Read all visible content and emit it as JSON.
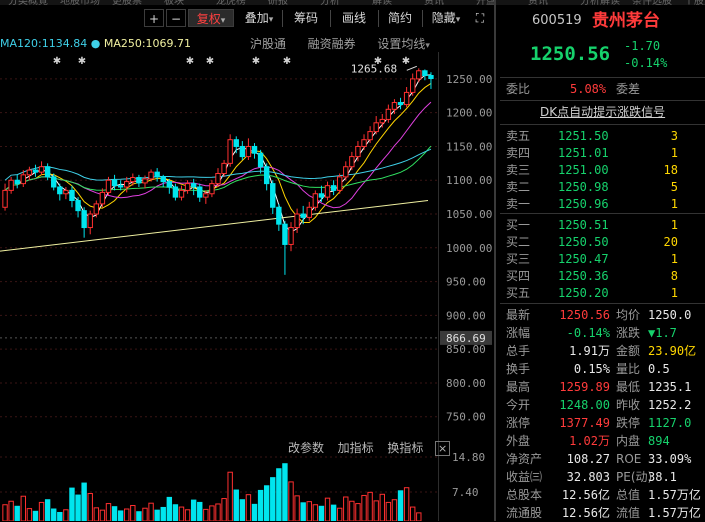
{
  "top_strip": [
    "分类概覧",
    "地股市场",
    "更股票",
    "板块",
    "龙虎榜",
    "研报",
    "分析",
    "解读",
    "资讯",
    "开盘",
    "资讯",
    "分析解读",
    "条件选股",
    "个股资讯"
  ],
  "toolbar": {
    "plus": "+",
    "minus": "−",
    "fuquan": "复权",
    "diejia": "叠加",
    "chouma": "筹码",
    "huaxian": "画线",
    "jianyue": "简约",
    "yincang": "隐藏",
    "dropdown_glyph": "▾",
    "expand_glyph": "⛶"
  },
  "ma_legend": [
    {
      "label": "MA120:1134.84",
      "color": "#3fd0e8"
    },
    {
      "label": "MA250:1069.71",
      "color": "#f0f0a0"
    }
  ],
  "chart_tabs": [
    "沪股通",
    "融资融券",
    "设置均线"
  ],
  "chart_tabs_dropdown": "▾",
  "price_axis": [
    "1250.00",
    "1200.00",
    "1150.00",
    "1100.00",
    "1050.00",
    "1000.00",
    "950.00",
    "900.00",
    "866.69",
    "850.00",
    "800.00",
    "750.00"
  ],
  "highlight_price": "866.69",
  "volume_axis": [
    "14.80",
    "7.40"
  ],
  "peak_label": "1265.68",
  "mid_tools": {
    "gaicanshu": "改参数",
    "jiazhibiao": "加指标",
    "huanzhibiao": "换指标",
    "close_glyph": "×"
  },
  "chart_data": {
    "type": "candlestick",
    "ylim": [
      720,
      1275
    ],
    "candles": [
      {
        "o": 1060,
        "c": 1085,
        "h": 1095,
        "l": 1055
      },
      {
        "o": 1085,
        "c": 1100,
        "h": 1105,
        "l": 1080
      },
      {
        "o": 1100,
        "c": 1095,
        "h": 1108,
        "l": 1088
      },
      {
        "o": 1095,
        "c": 1108,
        "h": 1115,
        "l": 1090
      },
      {
        "o": 1108,
        "c": 1115,
        "h": 1120,
        "l": 1100
      },
      {
        "o": 1115,
        "c": 1112,
        "h": 1123,
        "l": 1105
      },
      {
        "o": 1112,
        "c": 1120,
        "h": 1128,
        "l": 1108
      },
      {
        "o": 1120,
        "c": 1105,
        "h": 1125,
        "l": 1100
      },
      {
        "o": 1105,
        "c": 1090,
        "h": 1110,
        "l": 1085
      },
      {
        "o": 1090,
        "c": 1080,
        "h": 1095,
        "l": 1070
      },
      {
        "o": 1080,
        "c": 1085,
        "h": 1090,
        "l": 1072
      },
      {
        "o": 1085,
        "c": 1070,
        "h": 1092,
        "l": 1060
      },
      {
        "o": 1070,
        "c": 1055,
        "h": 1075,
        "l": 1045
      },
      {
        "o": 1055,
        "c": 1030,
        "h": 1060,
        "l": 1015
      },
      {
        "o": 1030,
        "c": 1050,
        "h": 1055,
        "l": 1020
      },
      {
        "o": 1050,
        "c": 1065,
        "h": 1070,
        "l": 1045
      },
      {
        "o": 1065,
        "c": 1082,
        "h": 1088,
        "l": 1060
      },
      {
        "o": 1082,
        "c": 1100,
        "h": 1105,
        "l": 1078
      },
      {
        "o": 1100,
        "c": 1092,
        "h": 1108,
        "l": 1085
      },
      {
        "o": 1092,
        "c": 1090,
        "h": 1100,
        "l": 1085
      },
      {
        "o": 1090,
        "c": 1098,
        "h": 1105,
        "l": 1082
      },
      {
        "o": 1098,
        "c": 1104,
        "h": 1110,
        "l": 1092
      },
      {
        "o": 1104,
        "c": 1096,
        "h": 1108,
        "l": 1090
      },
      {
        "o": 1096,
        "c": 1102,
        "h": 1107,
        "l": 1088
      },
      {
        "o": 1102,
        "c": 1112,
        "h": 1116,
        "l": 1098
      },
      {
        "o": 1112,
        "c": 1105,
        "h": 1118,
        "l": 1098
      },
      {
        "o": 1105,
        "c": 1098,
        "h": 1108,
        "l": 1090
      },
      {
        "o": 1098,
        "c": 1090,
        "h": 1102,
        "l": 1080
      },
      {
        "o": 1090,
        "c": 1075,
        "h": 1095,
        "l": 1070
      },
      {
        "o": 1075,
        "c": 1085,
        "h": 1092,
        "l": 1070
      },
      {
        "o": 1085,
        "c": 1095,
        "h": 1100,
        "l": 1080
      },
      {
        "o": 1095,
        "c": 1090,
        "h": 1102,
        "l": 1078
      },
      {
        "o": 1090,
        "c": 1075,
        "h": 1095,
        "l": 1068
      },
      {
        "o": 1075,
        "c": 1080,
        "h": 1085,
        "l": 1065
      },
      {
        "o": 1080,
        "c": 1095,
        "h": 1100,
        "l": 1075
      },
      {
        "o": 1095,
        "c": 1110,
        "h": 1118,
        "l": 1090
      },
      {
        "o": 1110,
        "c": 1125,
        "h": 1130,
        "l": 1105
      },
      {
        "o": 1125,
        "c": 1160,
        "h": 1168,
        "l": 1120
      },
      {
        "o": 1160,
        "c": 1150,
        "h": 1165,
        "l": 1140
      },
      {
        "o": 1150,
        "c": 1135,
        "h": 1158,
        "l": 1130
      },
      {
        "o": 1135,
        "c": 1150,
        "h": 1162,
        "l": 1130
      },
      {
        "o": 1150,
        "c": 1140,
        "h": 1155,
        "l": 1132
      },
      {
        "o": 1140,
        "c": 1120,
        "h": 1145,
        "l": 1110
      },
      {
        "o": 1120,
        "c": 1095,
        "h": 1125,
        "l": 1085
      },
      {
        "o": 1095,
        "c": 1060,
        "h": 1100,
        "l": 1050
      },
      {
        "o": 1060,
        "c": 1035,
        "h": 1065,
        "l": 1025
      },
      {
        "o": 1035,
        "c": 1005,
        "h": 1040,
        "l": 960
      },
      {
        "o": 1005,
        "c": 1030,
        "h": 1038,
        "l": 995
      },
      {
        "o": 1030,
        "c": 1050,
        "h": 1058,
        "l": 1022
      },
      {
        "o": 1050,
        "c": 1045,
        "h": 1062,
        "l": 1035
      },
      {
        "o": 1045,
        "c": 1060,
        "h": 1068,
        "l": 1040
      },
      {
        "o": 1060,
        "c": 1080,
        "h": 1085,
        "l": 1055
      },
      {
        "o": 1080,
        "c": 1075,
        "h": 1092,
        "l": 1068
      },
      {
        "o": 1075,
        "c": 1092,
        "h": 1098,
        "l": 1070
      },
      {
        "o": 1092,
        "c": 1085,
        "h": 1100,
        "l": 1078
      },
      {
        "o": 1085,
        "c": 1105,
        "h": 1110,
        "l": 1080
      },
      {
        "o": 1105,
        "c": 1120,
        "h": 1128,
        "l": 1100
      },
      {
        "o": 1120,
        "c": 1135,
        "h": 1142,
        "l": 1115
      },
      {
        "o": 1135,
        "c": 1150,
        "h": 1158,
        "l": 1128
      },
      {
        "o": 1150,
        "c": 1160,
        "h": 1168,
        "l": 1145
      },
      {
        "o": 1160,
        "c": 1172,
        "h": 1180,
        "l": 1155
      },
      {
        "o": 1172,
        "c": 1185,
        "h": 1195,
        "l": 1168
      },
      {
        "o": 1185,
        "c": 1190,
        "h": 1198,
        "l": 1178
      },
      {
        "o": 1190,
        "c": 1205,
        "h": 1212,
        "l": 1185
      },
      {
        "o": 1205,
        "c": 1215,
        "h": 1220,
        "l": 1198
      },
      {
        "o": 1215,
        "c": 1212,
        "h": 1222,
        "l": 1205
      },
      {
        "o": 1212,
        "c": 1230,
        "h": 1238,
        "l": 1208
      },
      {
        "o": 1230,
        "c": 1250,
        "h": 1258,
        "l": 1225
      },
      {
        "o": 1250,
        "c": 1262,
        "h": 1265.68,
        "l": 1245
      },
      {
        "o": 1262,
        "c": 1255,
        "h": 1264,
        "l": 1248
      },
      {
        "o": 1255,
        "c": 1250.56,
        "h": 1259.89,
        "l": 1235.1
      }
    ],
    "volumes": [
      4.2,
      5.1,
      3.8,
      6.4,
      3.2,
      2.5,
      4.8,
      5.5,
      3.1,
      2.2,
      2.9,
      8.5,
      6.7,
      9.8,
      7.1,
      3.4,
      2.8,
      4.5,
      3.7,
      2.6,
      3.1,
      4.0,
      2.4,
      3.3,
      4.6,
      2.8,
      3.5,
      6.1,
      4.2,
      3.6,
      2.9,
      5.4,
      4.8,
      3.0,
      3.9,
      4.4,
      5.8,
      12.6,
      8.0,
      5.5,
      6.8,
      4.3,
      7.9,
      9.1,
      11.2,
      13.5,
      14.8,
      10.1,
      6.5,
      4.7,
      5.0,
      4.2,
      3.8,
      5.9,
      4.1,
      3.3,
      6.2,
      5.1,
      4.5,
      6.6,
      7.4,
      5.2,
      6.9,
      4.8,
      5.5,
      7.8,
      8.6,
      3.6,
      2.1
    ]
  },
  "quote": {
    "code": "600519",
    "name": "贵州茅台",
    "price": "1250.56",
    "change": "-1.70",
    "change_pct": "-0.14%",
    "webi_label": "委比",
    "webi_value": "5.08%",
    "weicha_label": "委差",
    "signal_text": "DK点自动提示涨跌信号",
    "asks": [
      {
        "label": "卖五",
        "price": "1251.50",
        "vol": "3"
      },
      {
        "label": "卖四",
        "price": "1251.01",
        "vol": "1"
      },
      {
        "label": "卖三",
        "price": "1251.00",
        "vol": "18"
      },
      {
        "label": "卖二",
        "price": "1250.98",
        "vol": "5"
      },
      {
        "label": "卖一",
        "price": "1250.96",
        "vol": "1"
      }
    ],
    "bids": [
      {
        "label": "买一",
        "price": "1250.51",
        "vol": "1"
      },
      {
        "label": "买二",
        "price": "1250.50",
        "vol": "20"
      },
      {
        "label": "买三",
        "price": "1250.47",
        "vol": "1"
      },
      {
        "label": "买四",
        "price": "1250.36",
        "vol": "8"
      },
      {
        "label": "买五",
        "price": "1250.20",
        "vol": "1"
      }
    ],
    "stats": [
      {
        "l1": "最新",
        "v1": "1250.56",
        "c1": "red",
        "l2": "均价",
        "v2": "1250.0",
        "c2": "white"
      },
      {
        "l1": "涨幅",
        "v1": "-0.14%",
        "c1": "green",
        "l2": "涨跌",
        "v2": "▼1.7",
        "c2": "green"
      },
      {
        "l1": "总手",
        "v1": "1.91万",
        "c1": "white",
        "l2": "金额",
        "v2": "23.90亿",
        "c2": "yellow"
      },
      {
        "l1": "换手",
        "v1": "0.15%",
        "c1": "white",
        "l2": "量比",
        "v2": "0.5",
        "c2": "white"
      },
      {
        "l1": "最高",
        "v1": "1259.89",
        "c1": "red",
        "l2": "最低",
        "v2": "1235.1",
        "c2": "white"
      },
      {
        "l1": "今开",
        "v1": "1248.00",
        "c1": "green",
        "l2": "昨收",
        "v2": "1252.2",
        "c2": "white"
      },
      {
        "l1": "涨停",
        "v1": "1377.49",
        "c1": "red",
        "l2": "跌停",
        "v2": "1127.0",
        "c2": "green"
      },
      {
        "l1": "外盘",
        "v1": "1.02万",
        "c1": "red",
        "l2": "内盘",
        "v2": "894",
        "c2": "green"
      },
      {
        "l1": "净资产",
        "v1": "108.27",
        "c1": "white",
        "l2": "ROE",
        "v2": "33.09%",
        "c2": "white"
      },
      {
        "l1": "收益㈢",
        "v1": "32.803",
        "c1": "white",
        "l2": "PE(动)",
        "v2": "38.1",
        "c2": "white"
      },
      {
        "l1": "总股本",
        "v1": "12.56亿",
        "c1": "white",
        "l2": "总值",
        "v2": "1.57万亿",
        "c2": "white"
      },
      {
        "l1": "流通股",
        "v1": "12.56亿",
        "c1": "white",
        "l2": "流值",
        "v2": "1.57万亿",
        "c2": "white"
      }
    ]
  }
}
